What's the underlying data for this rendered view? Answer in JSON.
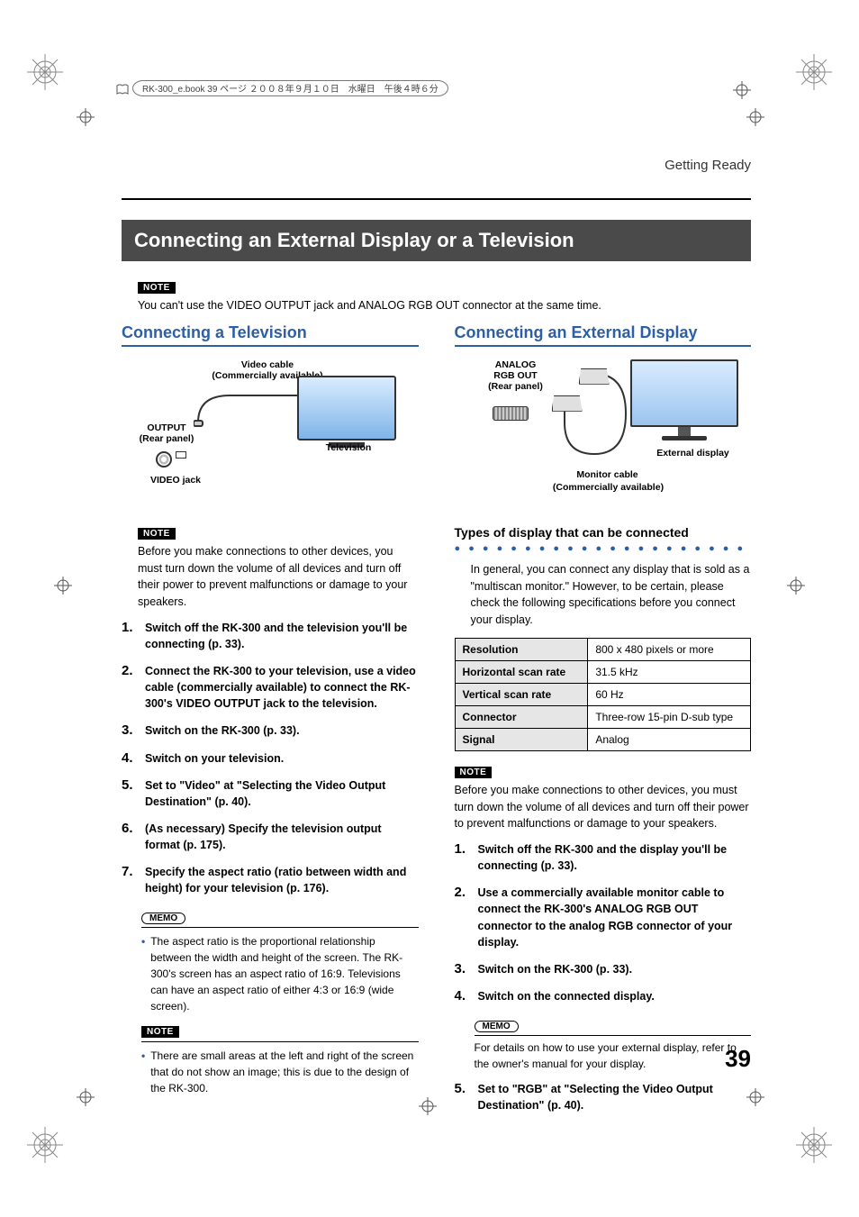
{
  "meta_header": "RK-300_e.book  39 ページ  ２００８年９月１０日　水曜日　午後４時６分",
  "running_head": "Getting Ready",
  "title": "Connecting an External Display or a Television",
  "top_note_badge": "NOTE",
  "top_note": "You can't use the VIDEO OUTPUT jack and ANALOG RGB OUT connector at the same time.",
  "tv": {
    "heading": "Connecting a Television",
    "diagram": {
      "video_cable_line1": "Video cable",
      "video_cable_line2": "(Commercially available)",
      "output_label": "OUTPUT",
      "rear_panel": "(Rear panel)",
      "video_jack": "VIDEO jack",
      "television": "Television"
    },
    "note_badge": "NOTE",
    "note": "Before you make connections to other devices, you must turn down the volume of all devices and turn off their power to prevent malfunctions or damage to your speakers.",
    "steps": [
      "Switch off the RK-300 and the television you'll be connecting (p. 33).",
      "Connect the RK-300 to your television, use a video cable (commercially available) to connect the RK-300's VIDEO OUTPUT jack to the television.",
      "Switch on the RK-300 (p. 33).",
      "Switch on your television.",
      "Set to \"Video\" at \"Selecting the Video Output Destination\" (p. 40).",
      "(As necessary) Specify the television output format (p. 175).",
      "Specify the aspect ratio (ratio between width and height) for your television (p. 176)."
    ],
    "memo_badge": "MEMO",
    "memo_bullet": "The aspect ratio is the proportional relationship between the width and height of the screen. The RK-300's screen has an aspect ratio of 16:9. Televisions can have an aspect ratio of either 4:3 or 16:9 (wide screen).",
    "lower_note_badge": "NOTE",
    "lower_note_bullet": "There are small areas at the left and right of the screen that do not show an image; this is due to the design of the RK-300."
  },
  "ext": {
    "heading": "Connecting an External Display",
    "diagram": {
      "analog_line1": "ANALOG",
      "analog_line2": "RGB OUT",
      "rear_panel": "(Rear panel)",
      "monitor_cable": "Monitor cable",
      "commercial": "(Commercially available)",
      "external_display": "External display"
    },
    "types_heading": "Types of display that can be connected",
    "types_intro": "In general, you can connect any display that is sold as a \"multiscan monitor.\" However, to be certain, please check the following specifications before you connect your display.",
    "specs": [
      {
        "label": "Resolution",
        "value": "800 x 480 pixels or more"
      },
      {
        "label": "Horizontal scan rate",
        "value": "31.5 kHz"
      },
      {
        "label": "Vertical scan rate",
        "value": "60 Hz"
      },
      {
        "label": "Connector",
        "value": "Three-row 15-pin D-sub type"
      },
      {
        "label": "Signal",
        "value": "Analog"
      }
    ],
    "note_badge": "NOTE",
    "note": "Before you make connections to other devices, you must turn down the volume of all devices and turn off their power to prevent malfunctions or damage to your speakers.",
    "steps": [
      "Switch off the RK-300 and the display you'll be connecting (p. 33).",
      "Use a commercially available monitor cable to connect the RK-300's ANALOG RGB OUT connector to the analog RGB connector of your display.",
      "Switch on the RK-300 (p. 33).",
      "Switch on the connected display."
    ],
    "memo_badge": "MEMO",
    "memo_text": "For details on how to use your external display, refer to the owner's manual for your display.",
    "step5": "Set to \"RGB\" at \"Selecting the Video Output Destination\" (p. 40)."
  },
  "page_number": "39"
}
